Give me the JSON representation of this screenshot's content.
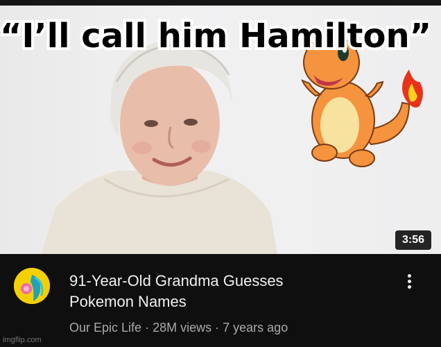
{
  "video": {
    "thumbnail_caption": "“I’ll call him Hamilton”",
    "duration": "3:56",
    "title_line1": "91-Year-Old Grandma Guesses",
    "title_line2": "Pokemon Names",
    "channel": "Our Epic Life",
    "views": "28M views",
    "age": "7 years ago",
    "separator": "·",
    "menu_icon": "more-vert-icon"
  },
  "watermark": "imgflip.com",
  "colors": {
    "background": "#0f0f0f",
    "title_text": "#f1f1f1",
    "meta_text": "#aaaaaa",
    "avatar_bg": "#f4d000"
  }
}
